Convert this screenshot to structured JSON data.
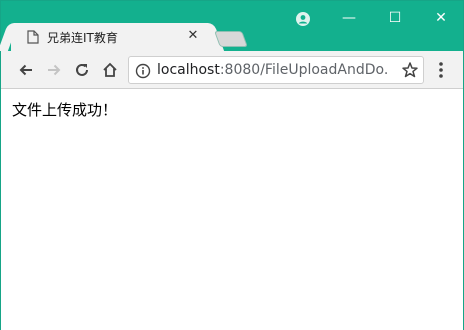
{
  "browser": {
    "tab": {
      "title": "兄弟连IT教育",
      "close_label": "✕"
    },
    "window_controls": {
      "minimize": "—",
      "maximize": "☐",
      "close": "✕"
    },
    "address": {
      "host": "localhost",
      "rest": ":8080/FileUploadAndDo..."
    },
    "icons": {
      "favicon": "document-icon",
      "profile": "profile-icon",
      "back": "back-arrow-icon",
      "forward": "forward-arrow-icon",
      "reload": "reload-icon",
      "home": "home-icon",
      "info": "info-icon",
      "bookmark": "star-icon",
      "menu": "kebab-menu-icon"
    },
    "colors": {
      "titlebar": "#13b08e",
      "toolbar": "#f2f2f2"
    }
  },
  "page": {
    "message": "文件上传成功！"
  }
}
